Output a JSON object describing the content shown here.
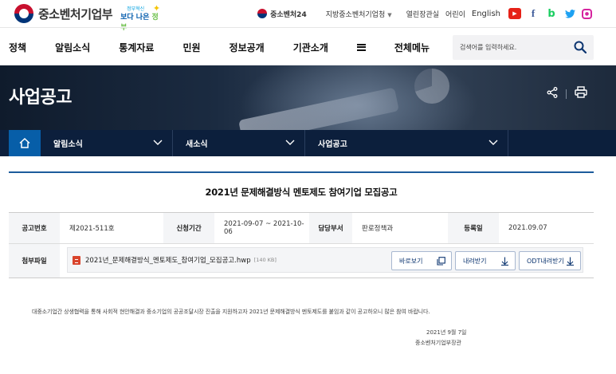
{
  "header": {
    "logo_text": "중소벤처기업부",
    "slogan_small": "정부혁신",
    "slogan_main_a": "보다 나은",
    "slogan_main_b": "정부",
    "util": {
      "jb24": "중소벤처24",
      "region": "지방중소벤처기업청",
      "links": [
        "열린장관실",
        "어린이"
      ],
      "english": "English"
    },
    "sns": [
      "youtube-icon",
      "facebook-icon",
      "blog-icon",
      "twitter-icon",
      "instagram-icon"
    ]
  },
  "nav": {
    "menu": [
      "정책",
      "알림소식",
      "통계자료",
      "민원",
      "정보공개",
      "기관소개"
    ],
    "full_menu": "전체메뉴",
    "search_placeholder": "검색어를 입력하세요."
  },
  "hero": {
    "title": "사업공고"
  },
  "breadcrumb": {
    "items": [
      "알림소식",
      "새소식",
      "사업공고"
    ]
  },
  "article": {
    "title": "2021년 문제해결방식 멘토제도 참여기업 모집공고",
    "labels": {
      "number": "공고번호",
      "period": "신청기간",
      "dept": "담당부서",
      "registered": "등록일",
      "attachment": "첨부파일"
    },
    "values": {
      "number": "제2021-511호",
      "period": "2021-09-07 ~ 2021-10-06",
      "dept": "판로정책과",
      "registered": "2021.09.07"
    },
    "attachment": {
      "filename": "2021년_문제해결방식_멘토제도_참여기업_모집공고.hwp",
      "size": "[140 KB]",
      "buttons": [
        "바로보기",
        "내려받기",
        "ODT내려받기"
      ]
    },
    "body": "대중소기업간 상생협력을 통해 사회적 현안해결과 중소기업의 공공조달시장 진출을 지원하고자 2021년 문제해결방식 멘토제도를 붙임과 같이 공고하오니 많은 참여 바랍니다.",
    "sign_date": "2021년 9월 7일",
    "sign_org": "중소벤처기업부장관"
  },
  "colors": {
    "brand_navy": "#0c1f3c",
    "home_blue": "#075ea8",
    "accent_line": "#1d5c9c"
  }
}
